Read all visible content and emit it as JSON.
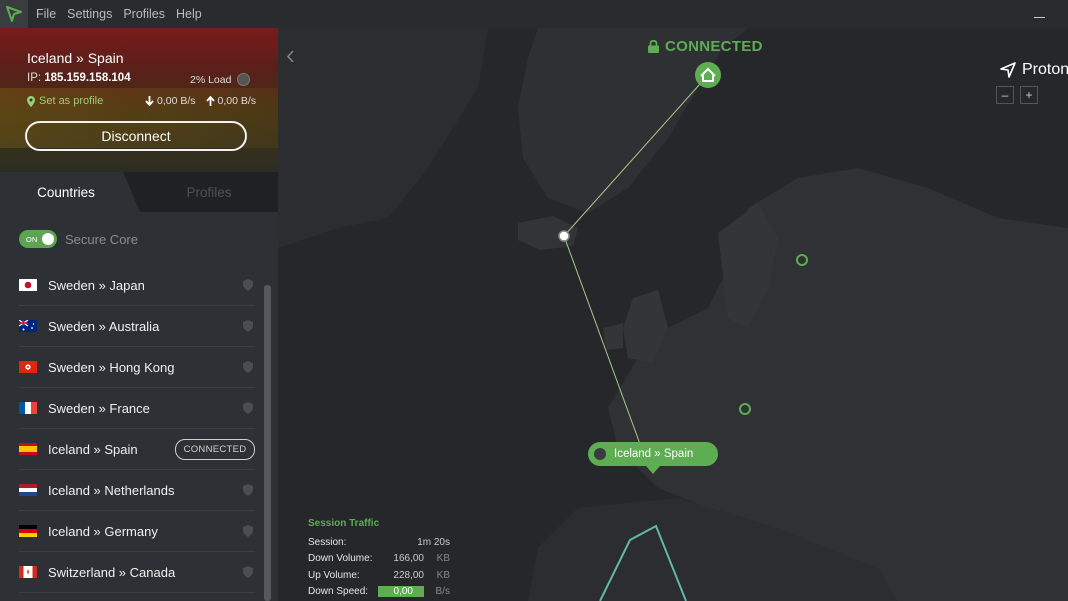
{
  "titlebar": {
    "menu": [
      "File",
      "Settings",
      "Profiles",
      "Help"
    ]
  },
  "status": {
    "route": "Iceland » Spain",
    "ip_label": "IP:",
    "ip": "185.159.158.104",
    "load": "2% Load",
    "set_profile": "Set as profile",
    "down_speed": "0,00 B/s",
    "up_speed": "0,00 B/s",
    "disconnect": "Disconnect"
  },
  "tabs": {
    "countries": "Countries",
    "profiles": "Profiles"
  },
  "secure_core": {
    "toggle": "ON",
    "label": "Secure Core"
  },
  "servers": [
    {
      "name": "Sweden » Japan",
      "flag": "japan"
    },
    {
      "name": "Sweden » Australia",
      "flag": "australia"
    },
    {
      "name": "Sweden » Hong Kong",
      "flag": "hongkong"
    },
    {
      "name": "Sweden » France",
      "flag": "france"
    },
    {
      "name": "Iceland » Spain",
      "flag": "spain",
      "badge": "CONNECTED"
    },
    {
      "name": "Iceland » Netherlands",
      "flag": "netherlands"
    },
    {
      "name": "Iceland » Germany",
      "flag": "germany"
    },
    {
      "name": "Switzerland » Canada",
      "flag": "canada"
    }
  ],
  "map": {
    "status": "CONNECTED",
    "brand": "Proton",
    "zoom_out": "–",
    "zoom_in": "+",
    "pin_label": "Iceland » Spain",
    "accent": "#5ead53"
  },
  "traffic": {
    "title": "Session Traffic",
    "session_label": "Session:",
    "session": "1m 20s",
    "down_volume_label": "Down Volume:",
    "down_volume": "166,00",
    "down_volume_unit": "KB",
    "up_volume_label": "Up Volume:",
    "up_volume": "228,00",
    "up_volume_unit": "KB",
    "down_speed_label": "Down Speed:",
    "down_speed": "0,00",
    "down_speed_unit": "B/s"
  }
}
